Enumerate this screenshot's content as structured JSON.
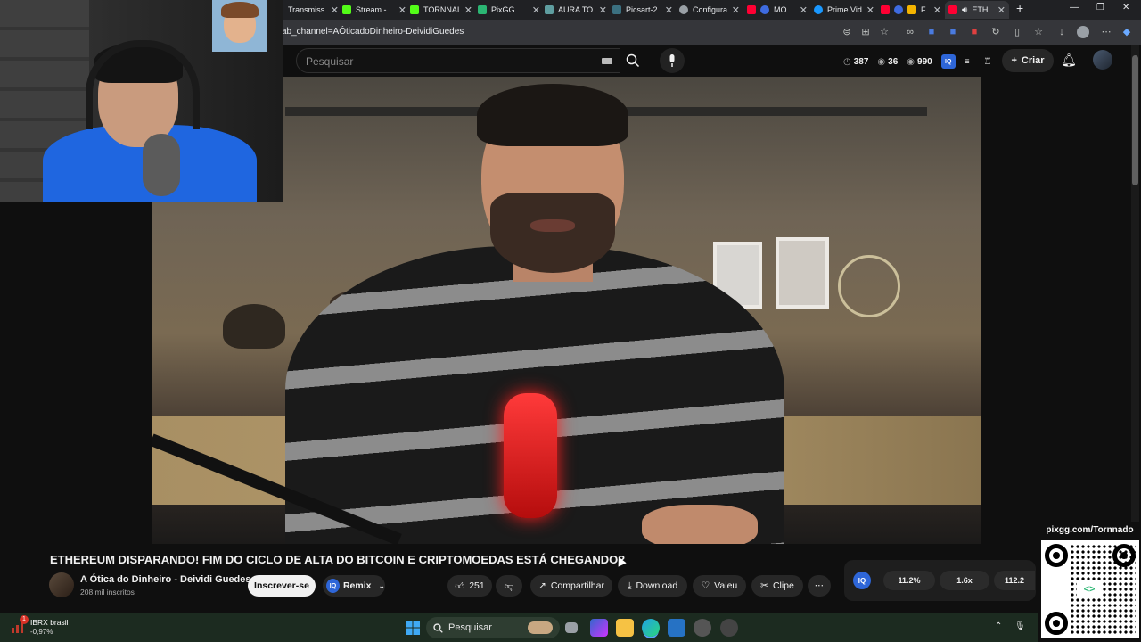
{
  "browser": {
    "tabs": [
      {
        "label": "Transmiss",
        "color": "#ff0033"
      },
      {
        "label": "Stream - ",
        "color": "#53fc18"
      },
      {
        "label": "TORNNAI",
        "color": "#53fc18"
      },
      {
        "label": "PixGG",
        "color": "#2bb673"
      },
      {
        "label": "AURA TO",
        "color": "#5f9ea0"
      },
      {
        "label": "Picsart-2",
        "color": "#3b7080"
      },
      {
        "label": "Configura",
        "color": "#9aa0a6"
      },
      {
        "label": "MO",
        "color": "#ff0033"
      },
      {
        "label": "Prime Vid",
        "color": "#1a98ff"
      },
      {
        "label": "F",
        "color": "#f4b400"
      },
      {
        "label": "ETH",
        "color": "#ff0033"
      }
    ],
    "url": "ab_channel=AÓticadoDinheiro-DeividiGuedes"
  },
  "youtube": {
    "search_placeholder": "Pesquisar",
    "stats": {
      "a": "387",
      "b": "36",
      "c": "990"
    },
    "create_label": "Criar",
    "video": {
      "title": "ETHEREUM DISPARANDO! FIM DO CICLO DE ALTA DO BITCOIN E CRIPTOMOEDAS ESTÁ CHEGANDO?",
      "channel": "A Ótica do Dinheiro - Deividi Guedes",
      "subscribers": "208 mil inscritos",
      "subscribe_label": "Inscrever-se",
      "remix_label": "Remix",
      "likes": "251",
      "share_label": "Compartilhar",
      "download_label": "Download",
      "thanks_label": "Valeu",
      "clip_label": "Clipe"
    },
    "iq_panel": {
      "stat1": "11.2%",
      "stat2": "1.6x",
      "stat3": "112.2"
    }
  },
  "overlay": {
    "pixgg_url": "pixgg.com/Tornnado",
    "badge_count": "1"
  },
  "taskbar": {
    "ticker_name": "IBRX brasil",
    "ticker_value": "-0,97%",
    "search_label": "Pesquisar"
  }
}
